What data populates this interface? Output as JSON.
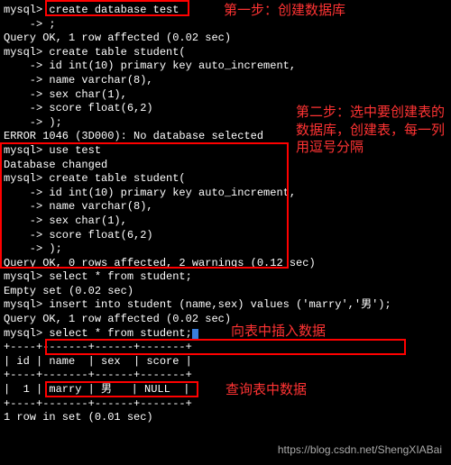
{
  "lines": {
    "l1": "mysql> create database test",
    "l2": "    -> ;",
    "l3": "Query OK, 1 row affected (0.02 sec)",
    "l4": "",
    "l5": "mysql> create table student(",
    "l6": "    -> id int(10) primary key auto_increment,",
    "l7": "    -> name varchar(8),",
    "l8": "    -> sex char(1),",
    "l9": "    -> score float(6,2)",
    "l10": "    -> );",
    "l11": "ERROR 1046 (3D000): No database selected",
    "l12": "mysql> use test",
    "l13": "Database changed",
    "l14": "mysql> create table student(",
    "l15": "    -> id int(10) primary key auto_increment,",
    "l16": "    -> name varchar(8),",
    "l17": "    -> sex char(1),",
    "l18": "    -> score float(6,2)",
    "l19": "    -> );",
    "l20": "Query OK, 0 rows affected, 2 warnings (0.12 sec)",
    "l21": "",
    "l22": "mysql> select * from student;",
    "l23": "Empty set (0.02 sec)",
    "l24": "",
    "l25": "mysql> insert into student (name,sex) values ('marry','男');",
    "l26": "Query OK, 1 row affected (0.02 sec)",
    "l27": "",
    "l28": "mysql> select * from student;",
    "l29": "+----+-------+------+-------+",
    "l30": "| id | name  | sex  | score |",
    "l31": "+----+-------+------+-------+",
    "l32": "|  1 | marry | 男   | NULL  |",
    "l33": "+----+-------+------+-------+",
    "l34": "1 row in set (0.01 sec)"
  },
  "annotations": {
    "step1": "第一步：创建数据库",
    "step2": "第二步：选中要创建表的数据库，创建表，每一列用逗号分隔",
    "step3": "向表中插入数据",
    "step4": "查询表中数据"
  },
  "watermark": "https://blog.csdn.net/ShengXIABai"
}
